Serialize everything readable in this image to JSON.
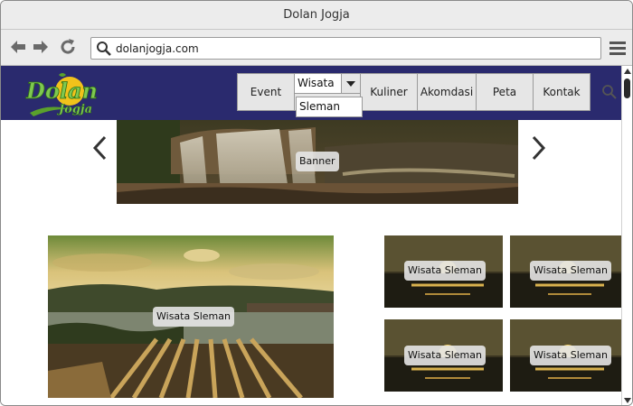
{
  "browser": {
    "window_title": "Dolan Jogja",
    "address": "dolanjogja.com"
  },
  "site": {
    "logo": {
      "line1": "Dolan",
      "line2": "Jogja"
    },
    "nav": {
      "event": "Event",
      "wisata_selected": "Wisata",
      "wisata_options": [
        "Sleman"
      ],
      "kuliner": "Kuliner",
      "akomodasi": "Akomdasi",
      "peta": "Peta",
      "kontak": "Kontak"
    },
    "banner": {
      "caption": "Banner"
    },
    "featured": {
      "caption": "Wisata Sleman"
    },
    "grid": [
      {
        "caption": "Wisata Sleman"
      },
      {
        "caption": "Wisata Sleman"
      },
      {
        "caption": "Wisata Sleman"
      },
      {
        "caption": "Wisata Sleman"
      }
    ]
  },
  "colors": {
    "header_bg": "#2a2a6e",
    "nav_bg": "#e6e6e6",
    "chrome_bg": "#ececec"
  },
  "icons": [
    "back-arrow-icon",
    "forward-arrow-icon",
    "reload-icon",
    "search-icon",
    "hamburger-menu-icon",
    "chevron-left-icon",
    "chevron-right-icon"
  ]
}
